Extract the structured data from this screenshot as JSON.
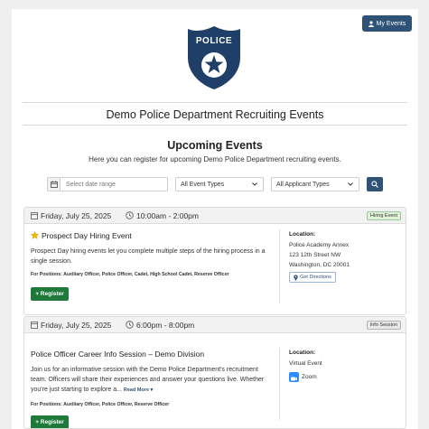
{
  "header": {
    "my_events_label": "My Events",
    "badge_text": "POLICE",
    "dept_title": "Demo Police Department Recruiting Events"
  },
  "intro": {
    "title": "Upcoming Events",
    "subtitle": "Here you can register for upcoming Demo Police Department recruiting events."
  },
  "filters": {
    "date_placeholder": "Select date range",
    "event_type": "All Event Types",
    "applicant_type": "All Applicant Types"
  },
  "events": [
    {
      "date": "Friday, July 25, 2025",
      "time": "10:00am - 2:00pm",
      "tag": "Hiring Event",
      "title": "Prospect Day Hiring Event",
      "description": "Prospect Day hiring events let you complete multiple steps of the hiring process in a single session.",
      "positions": "For Positions: Auxiliary Officer, Police Officer, Cadet, High School Cadet, Reserve Officer",
      "register_label": "Register",
      "location_label": "Location:",
      "location_lines": [
        "Police Academy Annex",
        "123 12th Street NW",
        "Washington, DC 20001"
      ],
      "directions_label": "Get Directions"
    },
    {
      "date": "Friday, July 25, 2025",
      "time": "6:00pm - 8:00pm",
      "tag": "Info Session",
      "title": "Police Officer Career Info Session – Demo Division",
      "description": "Join us for an informative session with the Demo Police Department's recruitment team. Officers will share their experiences and answer your questions live. Whether you're just starting to explore a...",
      "read_more": "Read More ▾",
      "positions": "For Positions: Auxiliary Officer, Police Officer, Reserve Officer",
      "register_label": "Register",
      "location_label": "Location:",
      "location_line": "Virtual Event",
      "platform": "Zoom"
    }
  ],
  "colors": {
    "navy": "#2f5277",
    "badge": "#1f3f68",
    "register_green": "#1f7a3a",
    "star": "#f5b800",
    "zoom_blue": "#2d8cff"
  }
}
